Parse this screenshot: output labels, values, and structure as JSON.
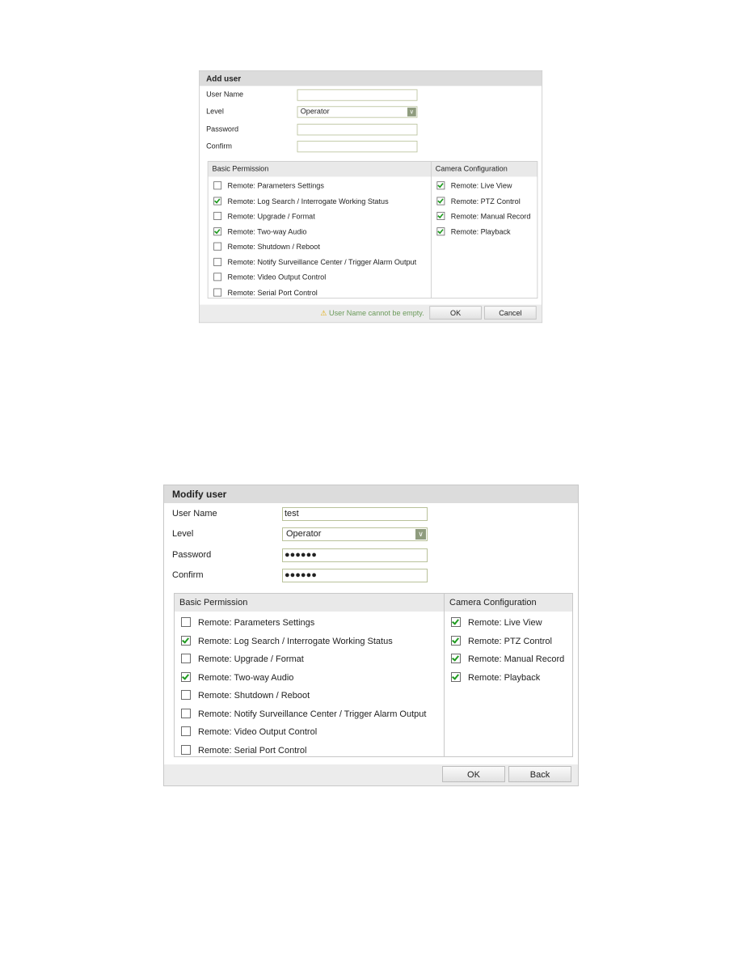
{
  "dialogs": [
    {
      "title": "Add user",
      "fields": {
        "user_name_label": "User Name",
        "user_name_value": "",
        "level_label": "Level",
        "level_value": "Operator",
        "password_label": "Password",
        "password_value": "",
        "confirm_label": "Confirm",
        "confirm_value": ""
      },
      "basic_header": "Basic Permission",
      "camera_header": "Camera Configuration",
      "basic": [
        {
          "label": "Remote: Parameters Settings",
          "checked": false
        },
        {
          "label": "Remote: Log Search / Interrogate Working Status",
          "checked": true
        },
        {
          "label": "Remote: Upgrade / Format",
          "checked": false
        },
        {
          "label": "Remote: Two-way Audio",
          "checked": true
        },
        {
          "label": "Remote: Shutdown / Reboot",
          "checked": false
        },
        {
          "label": "Remote: Notify Surveillance Center / Trigger Alarm Output",
          "checked": false
        },
        {
          "label": "Remote: Video Output Control",
          "checked": false
        },
        {
          "label": "Remote: Serial Port Control",
          "checked": false
        }
      ],
      "camera": [
        {
          "label": "Remote: Live View",
          "checked": true
        },
        {
          "label": "Remote: PTZ Control",
          "checked": true
        },
        {
          "label": "Remote: Manual Record",
          "checked": true
        },
        {
          "label": "Remote: Playback",
          "checked": true
        }
      ],
      "warning": "User Name cannot be empty.",
      "ok_label": "OK",
      "second_label": "Cancel"
    },
    {
      "title": "Modify user",
      "fields": {
        "user_name_label": "User Name",
        "user_name_value": "test",
        "level_label": "Level",
        "level_value": "Operator",
        "password_label": "Password",
        "password_value": "●●●●●●",
        "confirm_label": "Confirm",
        "confirm_value": "●●●●●●"
      },
      "basic_header": "Basic Permission",
      "camera_header": "Camera Configuration",
      "basic": [
        {
          "label": "Remote: Parameters Settings",
          "checked": false
        },
        {
          "label": "Remote: Log Search / Interrogate Working Status",
          "checked": true
        },
        {
          "label": "Remote: Upgrade / Format",
          "checked": false
        },
        {
          "label": "Remote: Two-way Audio",
          "checked": true
        },
        {
          "label": "Remote: Shutdown / Reboot",
          "checked": false
        },
        {
          "label": "Remote: Notify Surveillance Center / Trigger Alarm Output",
          "checked": false
        },
        {
          "label": "Remote: Video Output Control",
          "checked": false
        },
        {
          "label": "Remote: Serial Port Control",
          "checked": false
        }
      ],
      "camera": [
        {
          "label": "Remote: Live View",
          "checked": true
        },
        {
          "label": "Remote: PTZ Control",
          "checked": true
        },
        {
          "label": "Remote: Manual Record",
          "checked": true
        },
        {
          "label": "Remote: Playback",
          "checked": true
        }
      ],
      "ok_label": "OK",
      "second_label": "Back"
    }
  ]
}
